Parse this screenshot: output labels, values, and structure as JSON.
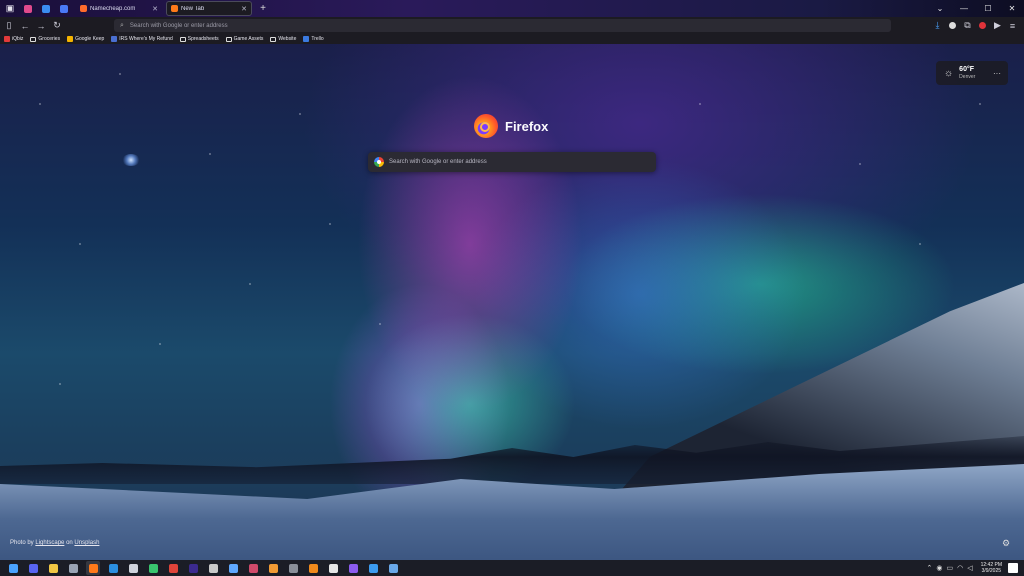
{
  "tabs": {
    "pinned": [
      {
        "name": "pinned-tab-1",
        "color": "#e04a8c"
      },
      {
        "name": "pinned-tab-2",
        "color": "#3b8df2"
      },
      {
        "name": "pinned-tab-3",
        "color": "#4a7af7"
      }
    ],
    "items": [
      {
        "label": "Namecheap.com",
        "color": "#ff6b2c",
        "active": false
      },
      {
        "label": "New Tab",
        "color": "#ff7a1a",
        "active": true
      }
    ],
    "new_tab_symbol": "+"
  },
  "window_controls": {
    "minimize": "—",
    "maximize": "☐",
    "close": "✕",
    "tab_list": "⌄"
  },
  "nav": {
    "back": "←",
    "forward": "→",
    "reload": "↻",
    "sidebar": "▯",
    "url_placeholder": "Search with Google or enter address",
    "menu": "≡"
  },
  "bookmarks": [
    {
      "label": "iQbiz",
      "type": "site",
      "color": "#e23a3a"
    },
    {
      "label": "Groceries",
      "type": "folder"
    },
    {
      "label": "Google Keep",
      "type": "site",
      "color": "#f5b400"
    },
    {
      "label": "IRS Where's My Refund",
      "type": "site",
      "color": "#4a6fd1"
    },
    {
      "label": "Spreadsheets",
      "type": "folder"
    },
    {
      "label": "Game Assets",
      "type": "folder"
    },
    {
      "label": "Website",
      "type": "folder"
    },
    {
      "label": "Trello",
      "type": "site",
      "color": "#3b7ae0"
    }
  ],
  "newtab": {
    "brand": "Firefox",
    "search_placeholder": "Search with Google or enter address"
  },
  "weather": {
    "temp": "60°F",
    "city": "Denver",
    "more": "···"
  },
  "credit": {
    "prefix": "Photo by",
    "author": "Lightscape",
    "on": "on",
    "source": "Unsplash"
  },
  "taskbar": {
    "time": "12:42 PM",
    "date": "3/9/2025",
    "apps": [
      {
        "name": "start-button",
        "color": "#4aa3ff"
      },
      {
        "name": "discord-app",
        "color": "#5865f2"
      },
      {
        "name": "file-explorer-app",
        "color": "#f2c744"
      },
      {
        "name": "steam-app",
        "color": "#9aa4b5"
      },
      {
        "name": "firefox-app",
        "color": "#ff7a1a",
        "active": true
      },
      {
        "name": "vscode-app",
        "color": "#2b8fe0"
      },
      {
        "name": "terminal-app",
        "color": "#cfd3dc"
      },
      {
        "name": "app-green",
        "color": "#39c56e"
      },
      {
        "name": "app-red",
        "color": "#e0443a"
      },
      {
        "name": "premiere-app",
        "color": "#3b2a8f"
      },
      {
        "name": "app-box",
        "color": "#c9c9c9"
      },
      {
        "name": "app-blue",
        "color": "#5fa8ff"
      },
      {
        "name": "app-mixed",
        "color": "#d04a6a"
      },
      {
        "name": "app-orange",
        "color": "#f29b34"
      },
      {
        "name": "app-dark",
        "color": "#8a8f99"
      },
      {
        "name": "blender-app",
        "color": "#f08a1c"
      },
      {
        "name": "app-white",
        "color": "#e6e6e6"
      },
      {
        "name": "app-purple",
        "color": "#8c5cf0"
      },
      {
        "name": "security-app",
        "color": "#3c9cf0"
      },
      {
        "name": "app-cube",
        "color": "#6aa8e8"
      }
    ]
  }
}
